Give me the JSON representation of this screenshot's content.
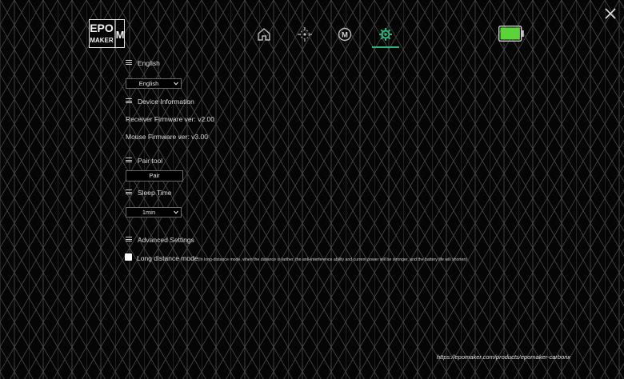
{
  "logo": {
    "line1": "EPO",
    "line2": "MAKER",
    "letter": "M"
  },
  "nav": {
    "items": [
      {
        "name": "home"
      },
      {
        "name": "dpi"
      },
      {
        "name": "macro",
        "letter": "M"
      },
      {
        "name": "settings",
        "active": true
      }
    ],
    "active_color": "#2fb27a"
  },
  "battery": {
    "level": 1.0,
    "color": "#5bd43a"
  },
  "language": {
    "section_title": "English",
    "select_value": "English"
  },
  "device_info": {
    "section_title": "Device Information",
    "receiver_firmware": "Receiver Firmware ver: v2.00",
    "mouse_firmware": "Mouse Firmware ver: v3.00"
  },
  "pair_tool": {
    "section_title": "Pair tool",
    "button_label": "Pair"
  },
  "sleep_time": {
    "section_title": "Sleep Time",
    "select_value": "1min"
  },
  "advanced": {
    "section_title": "Advanced Settings",
    "long_distance_label": "Long distance mode",
    "long_distance_hint": "(In long-distance mode, when the distance is farther, the anti-interference ability and current power will be stronger, and the battery life will shorten)",
    "long_distance_checked": false
  },
  "footer": {
    "url": "https://epomaker.com/products/epomaker-carbonx"
  }
}
